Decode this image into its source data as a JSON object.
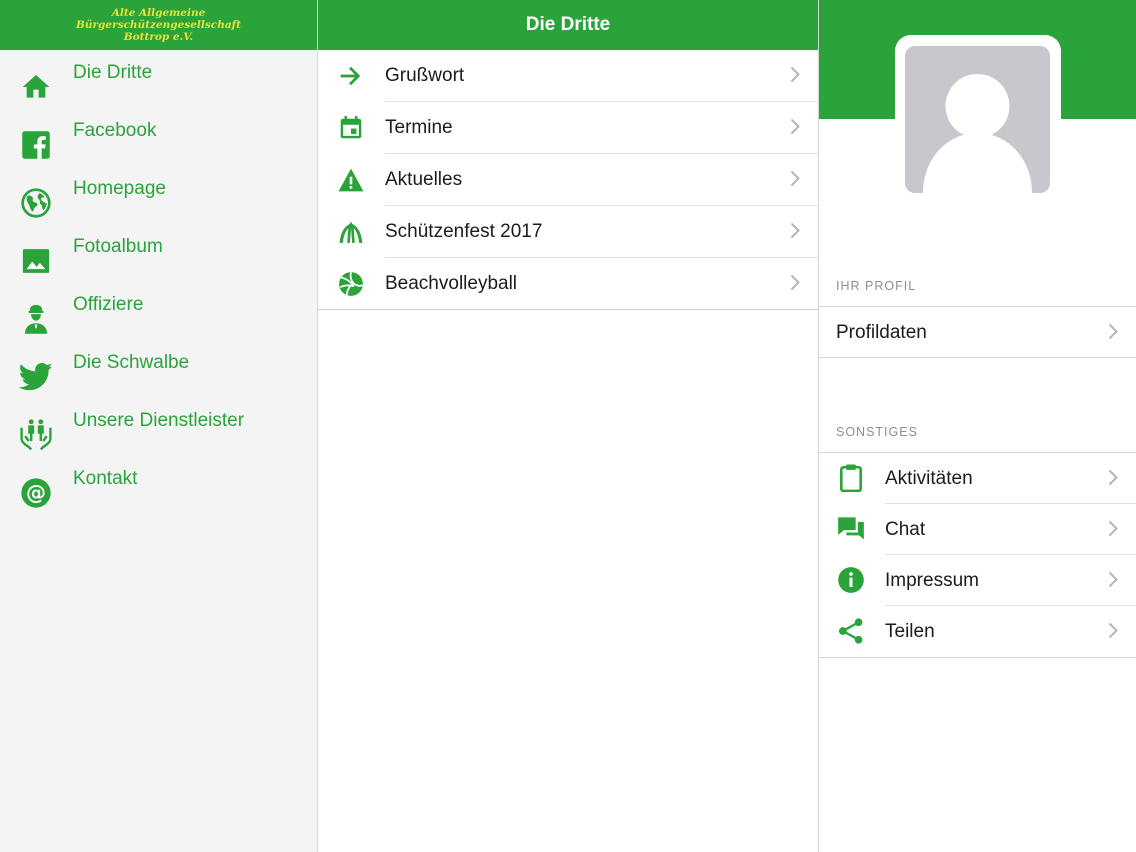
{
  "colors": {
    "accent": "#2aa33b",
    "logo_text": "#e8e23a"
  },
  "sidebar": {
    "logo_lines": [
      "Alte Allgemeine",
      "Bürgerschützengesellschaft",
      "Bottrop e.V."
    ],
    "items": [
      {
        "label": "Die Dritte",
        "icon": "home-icon"
      },
      {
        "label": "Facebook",
        "icon": "facebook-icon"
      },
      {
        "label": "Homepage",
        "icon": "globe-icon"
      },
      {
        "label": "Fotoalbum",
        "icon": "image-icon"
      },
      {
        "label": "Offiziere",
        "icon": "officer-icon"
      },
      {
        "label": "Die Schwalbe",
        "icon": "bird-icon"
      },
      {
        "label": "Unsere Dienstleister",
        "icon": "people-hands-icon"
      },
      {
        "label": "Kontakt",
        "icon": "at-icon"
      }
    ]
  },
  "main": {
    "title": "Die Dritte",
    "items": [
      {
        "label": "Grußwort",
        "icon": "arrow-right-icon"
      },
      {
        "label": "Termine",
        "icon": "calendar-icon"
      },
      {
        "label": "Aktuelles",
        "icon": "warning-icon"
      },
      {
        "label": "Schützenfest 2017",
        "icon": "tent-icon"
      },
      {
        "label": "Beachvolleyball",
        "icon": "volleyball-icon"
      }
    ]
  },
  "profile": {
    "section_profile": "IHR PROFIL",
    "profile_item": "Profildaten",
    "section_other": "SONSTIGES",
    "other_items": [
      {
        "label": "Aktivitäten",
        "icon": "clipboard-icon"
      },
      {
        "label": "Chat",
        "icon": "chat-icon"
      },
      {
        "label": "Impressum",
        "icon": "info-icon"
      },
      {
        "label": "Teilen",
        "icon": "share-icon"
      }
    ]
  }
}
